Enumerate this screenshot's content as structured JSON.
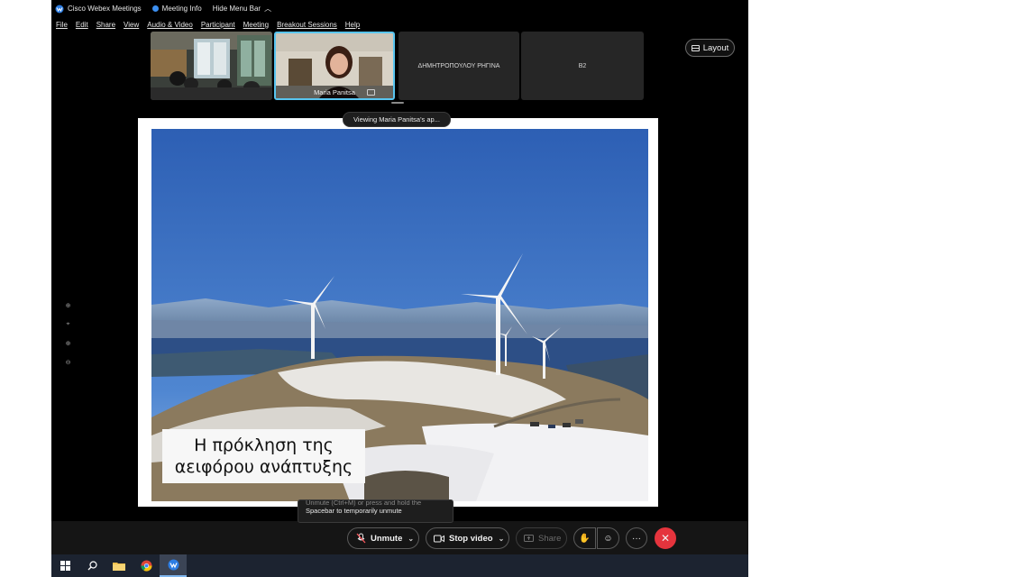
{
  "titlebar": {
    "app_name": "Cisco Webex Meetings",
    "meeting_info": "Meeting Info",
    "hide_menu_bar": "Hide Menu Bar"
  },
  "menu": [
    {
      "label": "File"
    },
    {
      "label": "Edit"
    },
    {
      "label": "Share"
    },
    {
      "label": "View"
    },
    {
      "label": "Audio & Video"
    },
    {
      "label": "Participant"
    },
    {
      "label": "Meeting"
    },
    {
      "label": "Breakout Sessions"
    },
    {
      "label": "Help"
    }
  ],
  "participants": {
    "active_speaker_name": "Maria Panitsa",
    "tile3_name": "ΔΗΜΗΤΡΟΠΟΥΛΟΥ ΡΗΓΙΝΑ",
    "tile4_name": "B2"
  },
  "layout_button": "Layout",
  "viewing_tooltip": "Viewing Maria Panitsa's ap...",
  "slide": {
    "caption_line1": "Η πρόκληση της",
    "caption_line2": "αειφόρου ανάπτυξης"
  },
  "unmute_tooltip": {
    "partial_line": "Unmute (Ctrl+M) or press and hold the",
    "line2": "Spacebar to temporarily unmute"
  },
  "controls": {
    "unmute": "Unmute",
    "stop_video": "Stop video",
    "share": "Share",
    "more": "···"
  },
  "colors": {
    "accent_border": "#58c5f0",
    "leave_red": "#e5343d",
    "sky": "#2f64b8"
  }
}
